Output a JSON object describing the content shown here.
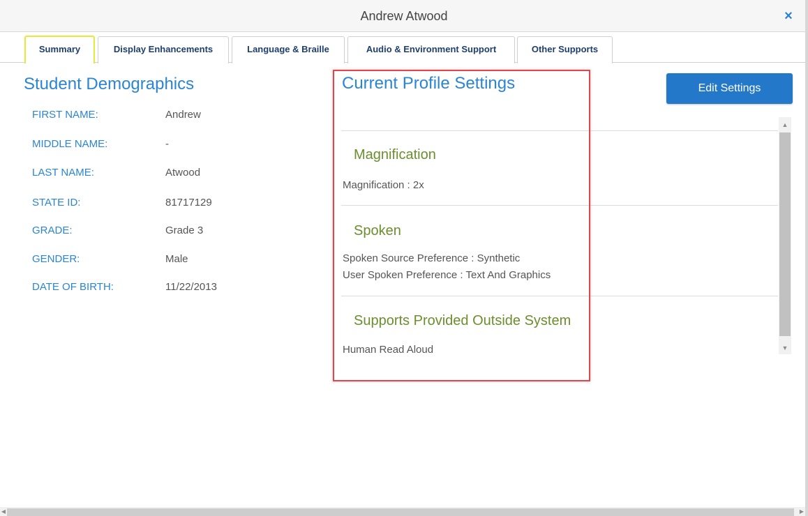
{
  "window": {
    "title": "Andrew Atwood",
    "close_glyph": "×"
  },
  "tabs": [
    {
      "label": "Summary",
      "active": true
    },
    {
      "label": "Display Enhancements",
      "active": false
    },
    {
      "label": "Language & Braille",
      "active": false
    },
    {
      "label": "Audio & Environment Support",
      "active": false
    },
    {
      "label": "Other Supports",
      "active": false
    }
  ],
  "demographics": {
    "heading": "Student Demographics",
    "fields": [
      {
        "label": "FIRST NAME:",
        "value": "Andrew"
      },
      {
        "label": "MIDDLE NAME:",
        "value": "-"
      },
      {
        "label": "LAST NAME:",
        "value": "Atwood"
      },
      {
        "label": "STATE ID:",
        "value": "81717129"
      },
      {
        "label": "GRADE:",
        "value": "Grade 3"
      },
      {
        "label": "GENDER:",
        "value": "Male"
      },
      {
        "label": "DATE OF BIRTH:",
        "value": "11/22/2013"
      }
    ]
  },
  "profile": {
    "heading": "Current Profile Settings",
    "edit_button": "Edit Settings",
    "sections": [
      {
        "title": "Magnification",
        "lines": [
          "Magnification : 2x"
        ]
      },
      {
        "title": "Spoken",
        "lines": [
          "Spoken Source Preference : Synthetic",
          "User Spoken Preference : Text And Graphics"
        ]
      },
      {
        "title": "Supports Provided Outside System",
        "lines": [
          "Human Read Aloud"
        ]
      }
    ]
  },
  "colors": {
    "accent": "#2a85d3",
    "section_title": "#6b8e2e",
    "highlight_box": "#e0474c",
    "active_tab_border": "#e9e83a",
    "button": "#2478c9"
  }
}
